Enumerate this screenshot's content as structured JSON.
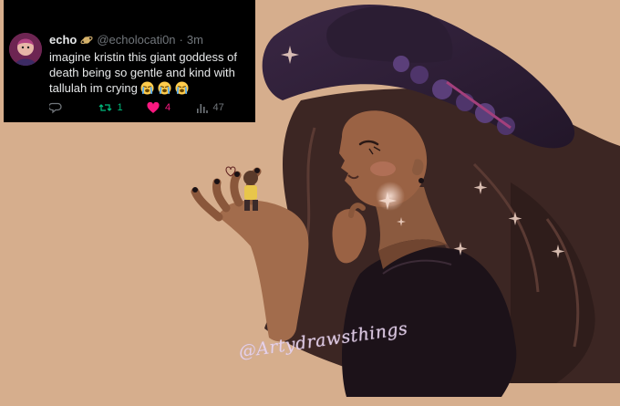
{
  "tweet": {
    "display_name": "echo",
    "name_badge_icon": "ringed-planet-icon",
    "handle": "@echolocati0n",
    "separator": "·",
    "time": "3m",
    "text": "imagine kristin this giant goddess of death being so gentle and kind with tallulah im crying",
    "emojis": [
      "loudly-crying-face-icon",
      "loudly-crying-face-icon",
      "loudly-crying-face-icon"
    ],
    "actions": {
      "reply_count": "",
      "retweet_count": "1",
      "like_count": "4",
      "views_count": "47"
    },
    "colors": {
      "background": "#000000",
      "text": "#e7e9ea",
      "muted": "#71767b",
      "retweet": "#00ba7c",
      "like": "#f91880"
    }
  },
  "artwork": {
    "background_color": "#d6ae8d",
    "signature": "@Artydrawsthings"
  }
}
